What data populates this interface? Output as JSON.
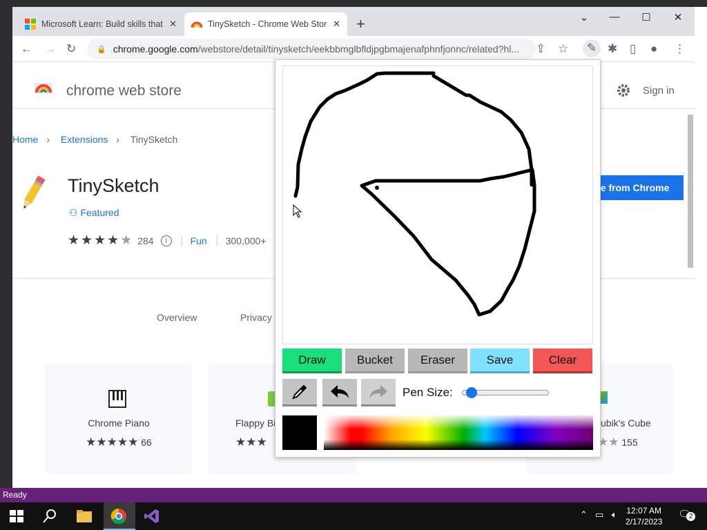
{
  "browser": {
    "tabs": [
      {
        "title": "Microsoft Learn: Build skills that o",
        "active": false
      },
      {
        "title": "TinySketch - Chrome Web Store",
        "active": true
      }
    ],
    "new_tab": "+",
    "url_host": "chrome.google.com",
    "url_path": "/webstore/detail/tinysketch/eekbbmglbfldjpgbmajenafphnfjonnc/related?hl..."
  },
  "store": {
    "brand": "chrome web store",
    "sign_in": "Sign in",
    "breadcrumb": [
      "Home",
      "Extensions",
      "TinySketch"
    ],
    "app_name": "TinySketch",
    "featured": "Featured",
    "rating": 4,
    "rating_count": "284",
    "category": "Fun",
    "users": "300,000+",
    "remove_button": "ve from Chrome",
    "tabs": [
      "Overview",
      "Privacy"
    ],
    "related": [
      {
        "name": "Chrome Piano",
        "rating": 4.5,
        "count": "66"
      },
      {
        "name": "Flappy Bi",
        "rating": 3,
        "count": ""
      },
      {
        "name": "ubik's Cube",
        "rating": 2,
        "count": "155"
      }
    ]
  },
  "popup": {
    "buttons": {
      "draw": "Draw",
      "bucket": "Bucket",
      "eraser": "Eraser",
      "save": "Save",
      "clear": "Clear"
    },
    "pen_size_label": "Pen Size:",
    "pen_size": 0.05,
    "current_color": "#000000"
  },
  "ide": {
    "status": "Ready"
  },
  "taskbar": {
    "time": "12:07 AM",
    "date": "2/17/2023",
    "notifications": "2"
  }
}
